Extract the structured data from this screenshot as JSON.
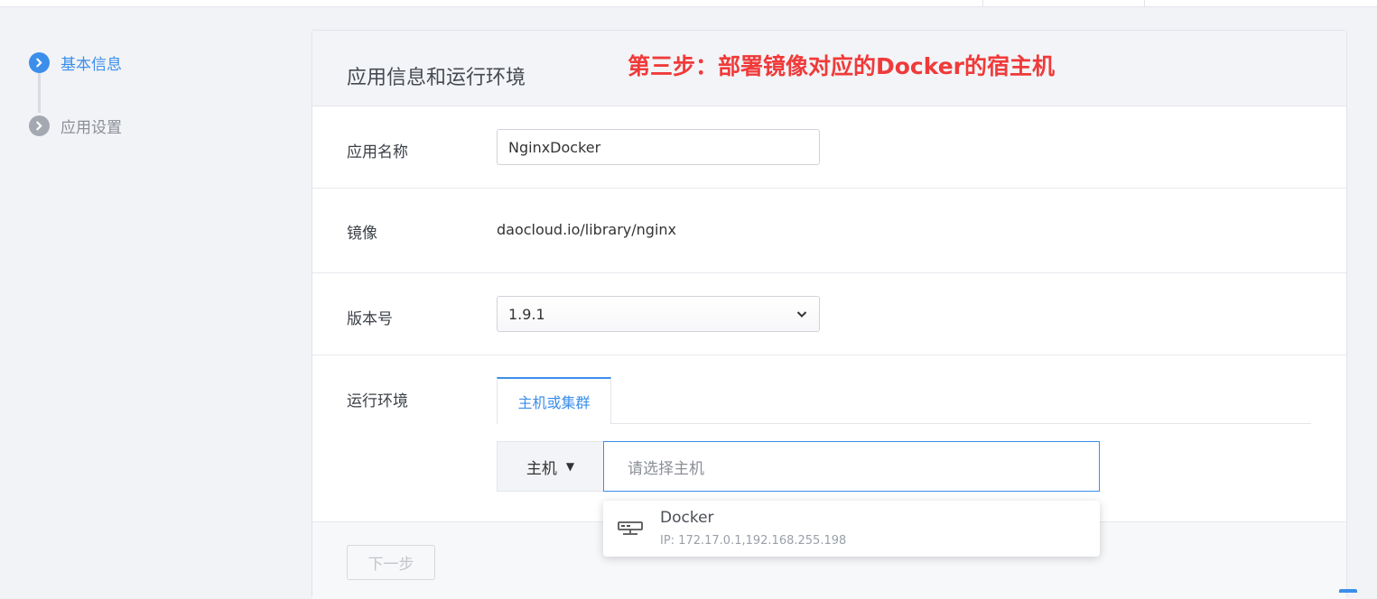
{
  "steps": [
    {
      "label": "基本信息",
      "state": "active",
      "icon": "chevron-right-icon"
    },
    {
      "label": "应用设置",
      "state": "inactive",
      "icon": "chevron-right-icon"
    }
  ],
  "card": {
    "title": "应用信息和运行环境",
    "annotation": "第三步：部署镜像对应的Docker的宿主机"
  },
  "form": {
    "app_name": {
      "label": "应用名称",
      "value": "NginxDocker"
    },
    "image": {
      "label": "镜像",
      "value": "daocloud.io/library/nginx"
    },
    "version": {
      "label": "版本号",
      "selected": "1.9.1"
    },
    "runtime": {
      "label": "运行环境",
      "tab": "主机或集群",
      "host_type": "主机",
      "host_placeholder": "请选择主机"
    }
  },
  "dropdown": {
    "item": {
      "name": "Docker",
      "ip": "IP: 172.17.0.1,192.168.255.198",
      "icon": "server-icon"
    }
  },
  "footer": {
    "next_label": "下一步"
  },
  "colors": {
    "accent": "#3b8eea",
    "annotation": "#f03a3a",
    "background": "#f2f3f7"
  }
}
